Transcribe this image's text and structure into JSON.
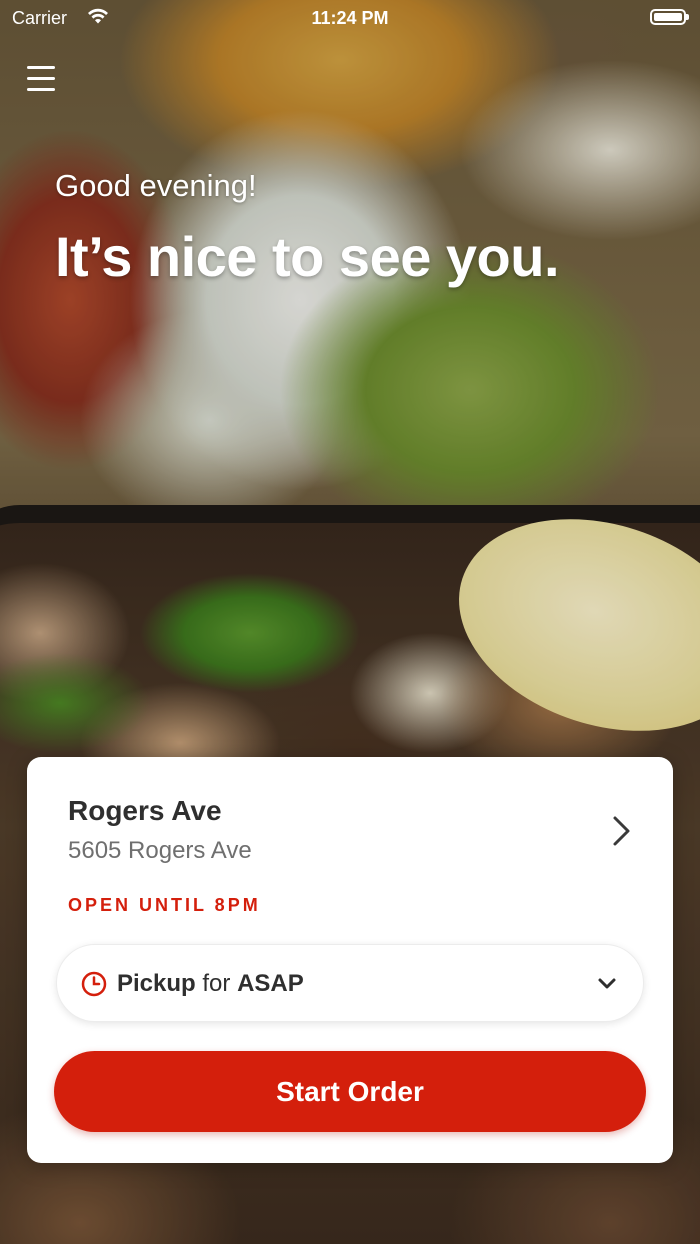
{
  "status_bar": {
    "carrier": "Carrier",
    "time": "11:24 PM",
    "wifi_icon": "wifi-icon",
    "battery_icon": "battery-icon"
  },
  "menu_icon": "hamburger-menu-icon",
  "greeting": {
    "salutation": "Good evening!",
    "headline": "It’s nice to see you."
  },
  "location_card": {
    "name": "Rogers Ave",
    "address": "5605 Rogers Ave",
    "open_status": "OPEN UNTIL 8PM",
    "chevron_icon": "chevron-right-icon",
    "pickup": {
      "icon": "clock-icon",
      "mode": "Pickup",
      "connector": "for",
      "time": "ASAP",
      "dropdown_icon": "chevron-down-icon"
    },
    "start_button_label": "Start Order"
  },
  "colors": {
    "accent": "#d41f0c",
    "card_background": "#ffffff",
    "text_primary": "#2f2f2f",
    "text_secondary": "#6f6f6f"
  }
}
